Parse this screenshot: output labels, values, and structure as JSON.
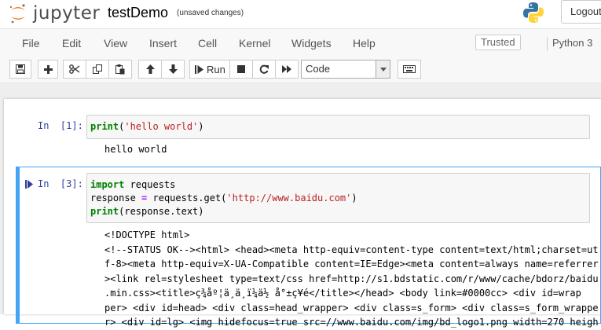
{
  "header": {
    "brand": "jupyter",
    "notebook_title": "testDemo",
    "autosave_status": "(unsaved changes)",
    "logout_label": "Logout",
    "logo_icon": "jupyter-logo-icon",
    "python_icon": "python-logo-icon"
  },
  "menubar": {
    "items": [
      "File",
      "Edit",
      "View",
      "Insert",
      "Cell",
      "Kernel",
      "Widgets",
      "Help"
    ],
    "trusted_label": "Trusted",
    "kernel_name": "Python 3"
  },
  "toolbar": {
    "buttons": [
      "save-icon",
      "plus-icon",
      "cut-icon",
      "copy-icon",
      "paste-icon",
      "arrow-up-icon",
      "arrow-down-icon",
      "run-icon",
      "stop-icon",
      "restart-icon",
      "fast-forward-icon",
      "keyboard-icon"
    ],
    "run_label": "Run",
    "cell_type": "Code"
  },
  "cells": [
    {
      "prompt": "In  [1]:",
      "code": "print('hello world')",
      "output": "hello world"
    },
    {
      "prompt": "In  [3]:",
      "code_lines": [
        "import requests",
        "response = requests.get('http://www.baidu.com')",
        "print(response.text)"
      ],
      "output_lines": [
        "<!DOCTYPE html>",
        "<!--STATUS OK--><html> <head><meta http-equiv=content-type content=text/html;charset=ut",
        "f-8><meta http-equiv=X-UA-Compatible content=IE=Edge><meta content=always name=referrer",
        "><link rel=stylesheet type=text/css href=http://s1.bdstatic.com/r/www/cache/bdorz/baidu",
        ".min.css><title>ç¾åº¦ä¸ä¸ï¼ä½ å°±ç¥é</title></head> <body link=#0000cc> <div id=wrap",
        "per> <div id=head> <div class=head_wrapper> <div class=s_form> <div class=s_form_wrappe",
        "r> <div id=lg> <img hidefocus=true src=//www.baidu.com/img/bd_logo1.png width=270 heigh"
      ]
    }
  ]
}
